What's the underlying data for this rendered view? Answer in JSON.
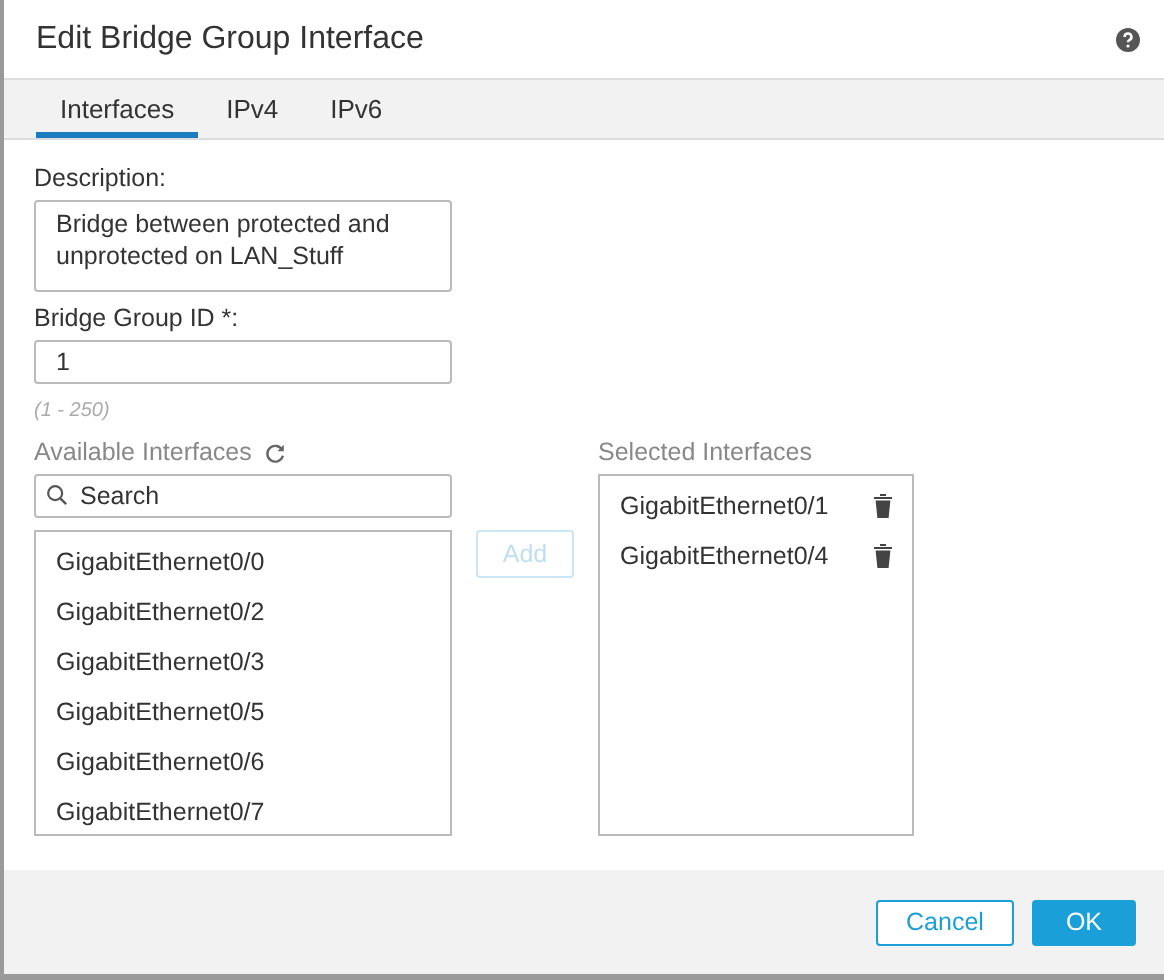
{
  "dialog": {
    "title": "Edit Bridge Group Interface"
  },
  "tabs": [
    {
      "label": "Interfaces",
      "selected": true
    },
    {
      "label": "IPv4",
      "selected": false
    },
    {
      "label": "IPv6",
      "selected": false
    }
  ],
  "description": {
    "label": "Description:",
    "value": "Bridge between protected and unprotected on LAN_Stuff"
  },
  "bridge_group_id": {
    "label": "Bridge Group ID *:",
    "value": "1",
    "hint": "(1 - 250)"
  },
  "available": {
    "label": "Available Interfaces",
    "search_placeholder": "Search",
    "items": [
      "GigabitEthernet0/0",
      "GigabitEthernet0/2",
      "GigabitEthernet0/3",
      "GigabitEthernet0/5",
      "GigabitEthernet0/6",
      "GigabitEthernet0/7"
    ]
  },
  "add_button": {
    "label": "Add",
    "disabled": true
  },
  "selected": {
    "label": "Selected Interfaces",
    "items": [
      "GigabitEthernet0/1",
      "GigabitEthernet0/4"
    ]
  },
  "buttons": [
    {
      "label": "Cancel",
      "kind": "secondary"
    },
    {
      "label": "OK",
      "kind": "primary"
    }
  ]
}
